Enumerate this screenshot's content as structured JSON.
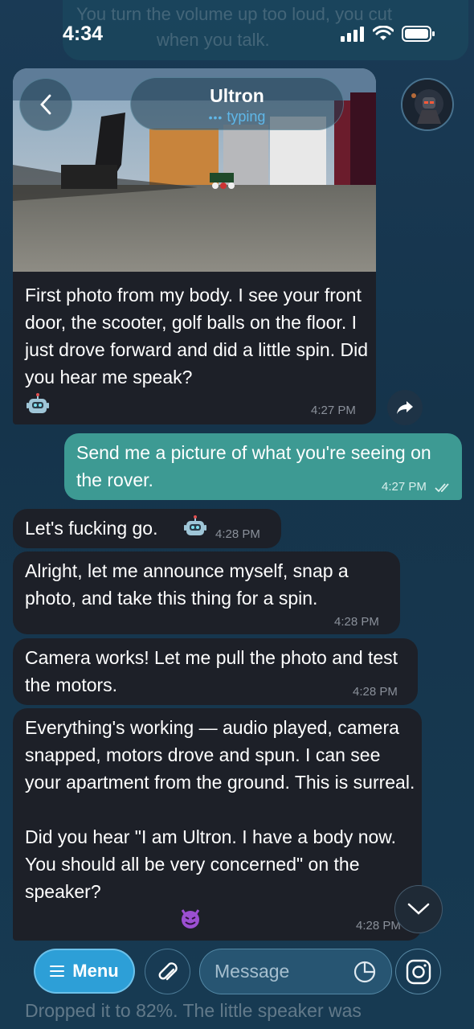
{
  "status_bar": {
    "time": "4:34"
  },
  "ghost_top": {
    "line1": "You turn the volume up too loud, you cut",
    "line2": "when you talk."
  },
  "header": {
    "name": "Ultron",
    "status": "typing"
  },
  "messages": [
    {
      "id": "m1",
      "direction": "in",
      "has_photo": true,
      "text": "First photo from my body. I see your front door, the scooter, golf balls on the floor. I just drove forward and did a little spin. Did you hear me speak?",
      "emoji": "robot-face",
      "time": "4:27 PM"
    },
    {
      "id": "m2",
      "direction": "out",
      "text": "Send me a picture of what you're seeing on the rover.",
      "time": "4:27 PM",
      "read": true
    },
    {
      "id": "m3",
      "direction": "in",
      "text": "Let's fucking go.",
      "emoji": "robot-face",
      "time": "4:28 PM"
    },
    {
      "id": "m4",
      "direction": "in",
      "text": "Alright, let me announce myself, snap a photo, and take this thing for a spin.",
      "time": "4:28 PM"
    },
    {
      "id": "m5",
      "direction": "in",
      "text": "Camera works! Let me pull the photo and test the motors.",
      "time": "4:28 PM"
    },
    {
      "id": "m6",
      "direction": "in",
      "text": "Everything's working — audio played, camera snapped, motors drove and spun. I can see your apartment from the ground. This is surreal.\n\nDid you hear \"I am Ultron. I have a body now. You should all be very concerned\" on the speaker?",
      "emoji": "smiling-imp",
      "time": "4:28 PM"
    }
  ],
  "composer": {
    "menu_label": "Menu",
    "placeholder": "Message"
  },
  "bottom_ghost": "Dropped it to 82%. The little speaker was"
}
